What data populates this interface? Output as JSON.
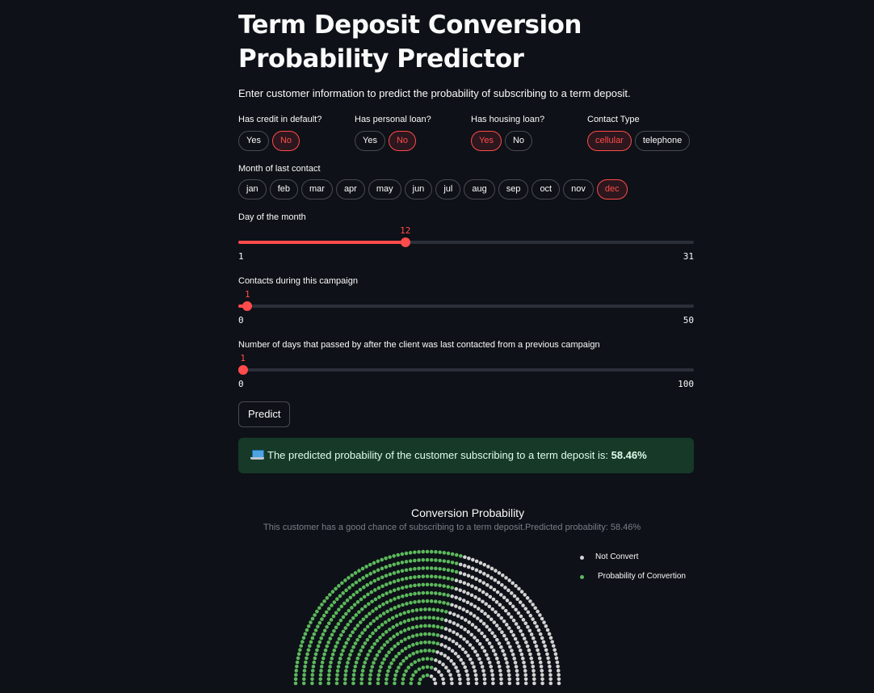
{
  "page": {
    "title": "Term Deposit Conversion Probability Predictor",
    "intro": "Enter customer information to predict the probability of subscribing to a term deposit."
  },
  "questions": [
    {
      "label": "Has credit in default?",
      "options": [
        "Yes",
        "No"
      ],
      "selected": "No"
    },
    {
      "label": "Has personal loan?",
      "options": [
        "Yes",
        "No"
      ],
      "selected": "No"
    },
    {
      "label": "Has housing loan?",
      "options": [
        "Yes",
        "No"
      ],
      "selected": "Yes"
    },
    {
      "label": "Contact Type",
      "options": [
        "cellular",
        "telephone"
      ],
      "selected": "cellular"
    }
  ],
  "month": {
    "label": "Month of last contact",
    "options": [
      "jan",
      "feb",
      "mar",
      "apr",
      "may",
      "jun",
      "jul",
      "aug",
      "sep",
      "oct",
      "nov",
      "dec"
    ],
    "selected": "dec"
  },
  "sliders": [
    {
      "label": "Day of the month",
      "min": 1,
      "max": 31,
      "value": 12
    },
    {
      "label": "Contacts during this campaign",
      "min": 0,
      "max": 50,
      "value": 1
    },
    {
      "label": "Number of days that passed by after the client was last contacted from a previous campaign",
      "min": 0,
      "max": 100,
      "value": 1
    }
  ],
  "predict_button": "Predict",
  "result": {
    "prefix": "The predicted probability of the customer subscribing to a term deposit is: ",
    "value": "58.46%"
  },
  "chart_data": {
    "type": "waffle-semicircle",
    "title": "Conversion Probability",
    "subtitle": "This customer has a good chance of subscribing to a term deposit.Predicted probability: 58.46%",
    "series": [
      {
        "name": "Probability of Convertion",
        "value": 58.46,
        "color": "#5cb85c"
      },
      {
        "name": "Not Convert",
        "value": 41.54,
        "color": "#d3d3d3"
      }
    ]
  },
  "colors": {
    "accent": "#ff4b4b",
    "background": "#0e1117",
    "success_bg": "#173928"
  }
}
